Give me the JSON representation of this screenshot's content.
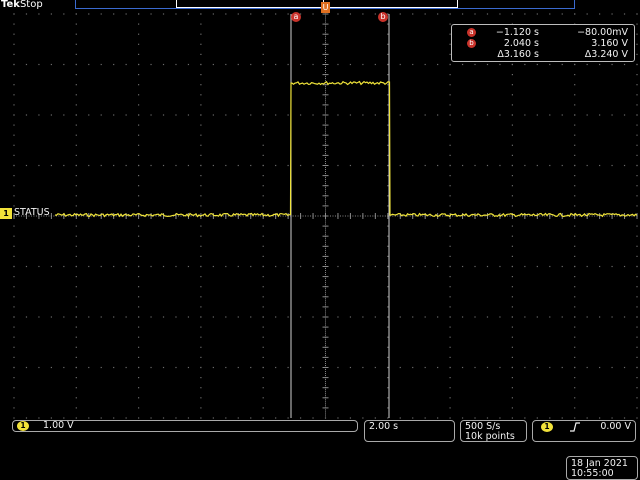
{
  "header": {
    "brand": "Tek",
    "run_state": "Stop"
  },
  "trace": {
    "color": "#f0e43a",
    "low_level": "-80.00mV",
    "high_level": "3.160 V"
  },
  "channel": {
    "number": "1",
    "label": "STATUS"
  },
  "cursors": {
    "a": {
      "badge": "a",
      "time": "−1.120 s",
      "value": "−80.00mV"
    },
    "b": {
      "badge": "b",
      "time": "2.040 s",
      "value": "3.160 V"
    },
    "delta": {
      "time": "Δ3.160 s",
      "value": "Δ3.240 V"
    }
  },
  "trigger_marker": "U",
  "bottom": {
    "ch_badge": "1",
    "ch_scale": "1.00 V",
    "time_scale": "2.00 s",
    "sample_rate": "500 S/s",
    "record_length": "10k points",
    "trig_badge": "1",
    "trig_slope_icon": "rising-edge-icon",
    "trig_level": "0.00 V",
    "date": "18 Jan  2021",
    "time": "10:55:00"
  }
}
